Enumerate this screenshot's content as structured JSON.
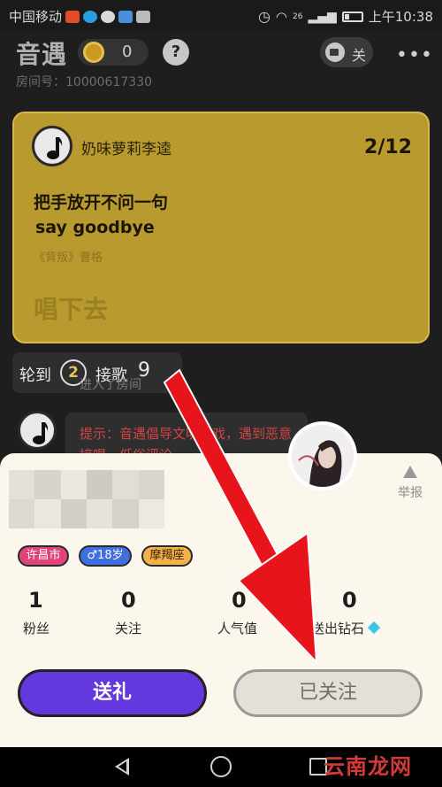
{
  "status_bar": {
    "carrier": "中国移动",
    "time": "上午10:38",
    "network": "26",
    "app_icon_colors": [
      "#e04b2a",
      "#2a9fe0",
      "#d9d9d9",
      "#4a90d9",
      "#bbbbbb"
    ]
  },
  "header": {
    "app_title": "音遇",
    "coin_count": "0",
    "help_label": "?",
    "room_id": "房间号：10000617330",
    "camera_label": "关",
    "more_label": "•••"
  },
  "song_card": {
    "singer": "奶味萝莉李逵",
    "progress": "2/12",
    "lyric_line1": "把手放开不问一句",
    "lyric_line2": "say goodbye",
    "song_source": "《背叛》曹格",
    "action": "唱下去"
  },
  "turn": {
    "label_prefix": "轮到",
    "turn_number": "2",
    "label_action": "接歌",
    "count": "9"
  },
  "chat": {
    "join_message": "进入了房间",
    "tip_message": "提示：音遇倡导文明游戏，遇到恶意接唱、低俗评论"
  },
  "profile": {
    "report_label": "举报",
    "tags": {
      "city": "许昌市",
      "gender_age": "♂18岁",
      "zodiac": "摩羯座"
    },
    "stats": [
      {
        "value": "1",
        "label": "粉丝"
      },
      {
        "value": "0",
        "label": "关注"
      },
      {
        "value": "0",
        "label": "人气值"
      },
      {
        "value": "0",
        "label": "送出钻石"
      }
    ],
    "gift_button": "送礼",
    "follow_button": "已关注"
  },
  "watermark": "云南龙网",
  "colors": {
    "card_bg": "#b89a2e",
    "gift_button": "#6338dd",
    "arrow": "#e8141c",
    "tip_text": "#d14444"
  }
}
